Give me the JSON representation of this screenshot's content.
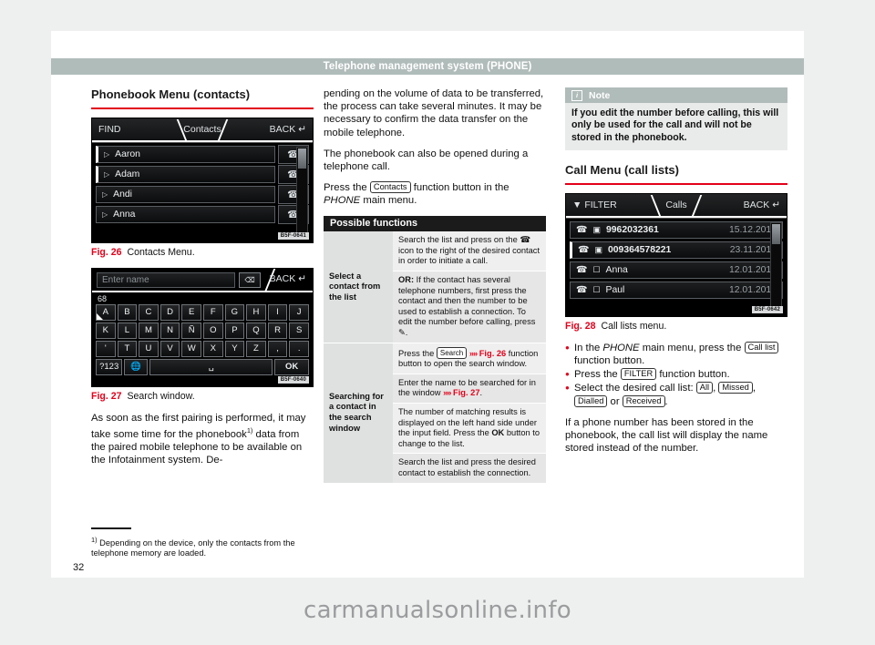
{
  "header": {
    "title": "Telephone management system (PHONE)"
  },
  "page_number": "32",
  "watermark": "carmanualsonline.info",
  "left_column": {
    "section_title": "Phonebook Menu (contacts)",
    "contacts_screen": {
      "tab_left": "FIND",
      "tab_center": "Contacts",
      "tab_right": "BACK",
      "back_icon": "return-arrow-icon",
      "call_icon": "handset-icon",
      "rows": [
        {
          "name": "Aaron",
          "selected": false
        },
        {
          "name": "Adam",
          "selected": true
        },
        {
          "name": "Andi",
          "selected": false
        },
        {
          "name": "Anna",
          "selected": false
        }
      ],
      "image_code": "B5F-0641"
    },
    "fig26": {
      "number": "Fig. 26",
      "caption": "Contacts Menu."
    },
    "keyboard_screen": {
      "input_placeholder": "Enter name",
      "delete_icon": "backspace-icon",
      "back_label": "BACK",
      "match_count": "68",
      "row1": [
        "A",
        "B",
        "C",
        "D",
        "E",
        "F",
        "G",
        "H",
        "I",
        "J"
      ],
      "row2": [
        "K",
        "L",
        "M",
        "N",
        "Ñ",
        "O",
        "P",
        "Q",
        "R",
        "S"
      ],
      "row3": [
        "'",
        "T",
        "U",
        "V",
        "W",
        "X",
        "Y",
        "Z",
        ",",
        "."
      ],
      "row4": {
        "symbols": "?123",
        "globe": "globe-icon",
        "space": "␣",
        "ok": "OK"
      },
      "image_code": "B5F-0640"
    },
    "fig27": {
      "number": "Fig. 27",
      "caption": "Search window."
    },
    "body_paragraph": "As soon as the first pairing is performed, it may take some time for the phonebook",
    "body_paragraph_sup": "1)",
    "body_paragraph_cont": " data from the paired mobile telephone to be available on the Infotainment system. De-"
  },
  "footnote": {
    "marker": "1)",
    "text": "Depending on the device, only the contacts from the telephone memory are loaded."
  },
  "middle_column": {
    "para1": "pending on the volume of data to be transferred, the process can take several minutes. It may be necessary to confirm the data transfer on the mobile telephone.",
    "para2": "The phonebook can also be opened during a telephone call.",
    "para3_pre": "Press the ",
    "para3_btn": "Contacts",
    "para3_mid": " function button in the ",
    "para3_ital": "PHONE",
    "para3_post": " main menu.",
    "table": {
      "header": "Possible functions",
      "rows": [
        {
          "label": "Select a contact from the list",
          "cells": [
            "Search the list and press on the ✎ icon to the right of the desired contact in order to initiate a call.",
            "OR: If the contact has several telephone numbers, first press the contact and then the number to be used to establish a connection. To edit the number before calling, press ✏."
          ]
        },
        {
          "label": "Searching for a contact in the search window",
          "cells": [
            "Press the Search ⋙ Fig. 26 function button to open the search window.",
            "Enter the name to be searched for in the window ⋙ Fig. 27.",
            "The number of matching results is displayed on the left hand side under the input field. Press the OK button to change to the list.",
            "Search the list and press the desired contact to establish the connection."
          ]
        }
      ]
    }
  },
  "right_column": {
    "note": {
      "icon": "info-icon",
      "title": "Note",
      "text": "If you edit the number before calling, this will only be used for the call and will not be stored in the phonebook."
    },
    "section_title": "Call Menu (call lists)",
    "calls_screen": {
      "tab_left": "FILTER",
      "filter_icon": "funnel-icon",
      "tab_center": "Calls",
      "tab_right": "BACK",
      "rows": [
        {
          "call_icon": "missed-call-icon",
          "device_icon": "landline-icon",
          "name": "9962032361",
          "date": "15.12.2014",
          "selected": false
        },
        {
          "call_icon": "outgoing-call-icon",
          "device_icon": "landline-icon",
          "name": "009364578221",
          "date": "23.11.2014",
          "selected": true
        },
        {
          "call_icon": "incoming-call-icon",
          "device_icon": "mobile-icon",
          "name": "Anna",
          "date": "12.01.2015",
          "selected": false
        },
        {
          "call_icon": "incoming-call-icon",
          "device_icon": "mobile-icon",
          "name": "Paul",
          "date": "12.01.2015",
          "selected": false
        }
      ],
      "image_code": "B5F-0642"
    },
    "fig28": {
      "number": "Fig. 28",
      "caption": "Call lists menu."
    },
    "bullets": [
      {
        "pre": "In the ",
        "ital": "PHONE",
        "mid": " main menu, press the ",
        "btn": "Call list",
        "post": " function button."
      },
      {
        "pre": "Press the ",
        "btn": "FILTER",
        "post": " function button."
      },
      {
        "pre": "Select the desired call list: ",
        "btns": [
          "All",
          "Missed",
          "Dialled",
          "Received"
        ],
        "post": "."
      }
    ],
    "closing_paragraph": "If a phone number has been stored in the phonebook, the call list will display the name stored instead of the number."
  }
}
